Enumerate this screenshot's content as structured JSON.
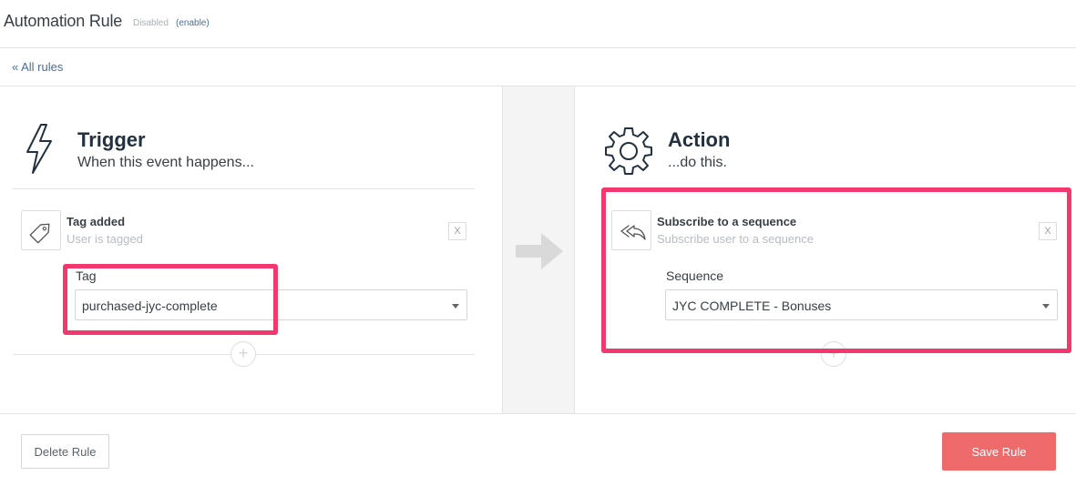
{
  "header": {
    "title": "Automation Rule",
    "status": "Disabled",
    "enable_link": "(enable)"
  },
  "nav": {
    "back_link": "« All rules"
  },
  "trigger": {
    "title": "Trigger",
    "subtitle": "When this event happens...",
    "icon": "lightning-bolt-icon",
    "card": {
      "title": "Tag added",
      "description": "User is tagged",
      "icon": "tag-icon",
      "remove_label": "X",
      "field_label": "Tag",
      "selected_value": "purchased-jyc-complete"
    },
    "add_label": "+"
  },
  "action": {
    "title": "Action",
    "subtitle": "...do this.",
    "icon": "gear-icon",
    "card": {
      "title": "Subscribe to a sequence",
      "description": "Subscribe user to a sequence",
      "icon": "reply-all-icon",
      "remove_label": "X",
      "field_label": "Sequence",
      "selected_value": "JYC COMPLETE - Bonuses"
    },
    "add_label": "+"
  },
  "footer": {
    "delete_label": "Delete Rule",
    "save_label": "Save Rule"
  },
  "colors": {
    "highlight": "#f2386f",
    "save_button": "#ef6b6b",
    "link": "#4a6e99"
  }
}
